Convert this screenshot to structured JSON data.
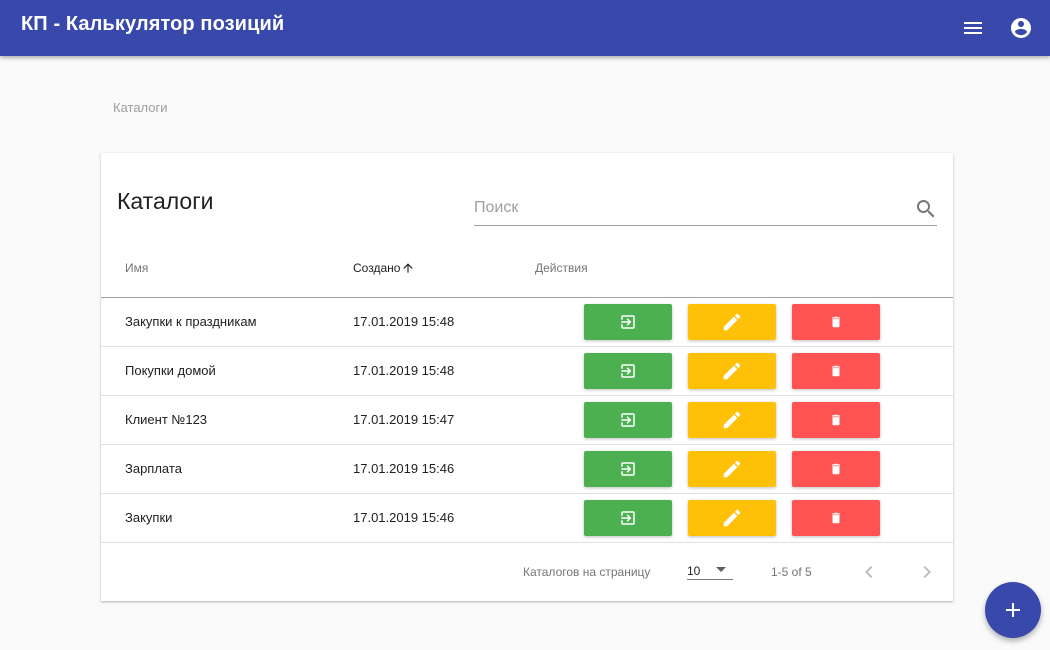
{
  "app": {
    "title": "КП - Калькулятор позиций"
  },
  "breadcrumb": "Каталоги",
  "colors": {
    "primary": "#3949ab",
    "open": "#4caf50",
    "edit": "#ffc107",
    "delete": "#ff5252"
  },
  "card": {
    "title": "Каталоги",
    "search_placeholder": "Поиск"
  },
  "table": {
    "headers": {
      "name": "Имя",
      "created": "Создано",
      "actions": "Действия"
    },
    "rows": [
      {
        "name": "Закупки к праздникам",
        "created": "17.01.2019 15:48"
      },
      {
        "name": "Покупки домой",
        "created": "17.01.2019 15:48"
      },
      {
        "name": "Клиент №123",
        "created": "17.01.2019 15:47"
      },
      {
        "name": "Зарплата",
        "created": "17.01.2019 15:46"
      },
      {
        "name": "Закупки",
        "created": "17.01.2019 15:46"
      }
    ]
  },
  "paginator": {
    "label": "Каталогов на страницу",
    "page_size": "10",
    "range": "1-5 of 5"
  },
  "icons": {
    "menu": "menu-icon",
    "account": "account-circle-icon",
    "search": "search-icon",
    "sort": "arrow-upward-icon",
    "open": "login-icon",
    "edit": "pencil-icon",
    "delete": "trash-icon",
    "prev": "chevron-left-icon",
    "next": "chevron-right-icon",
    "add": "plus-icon"
  }
}
